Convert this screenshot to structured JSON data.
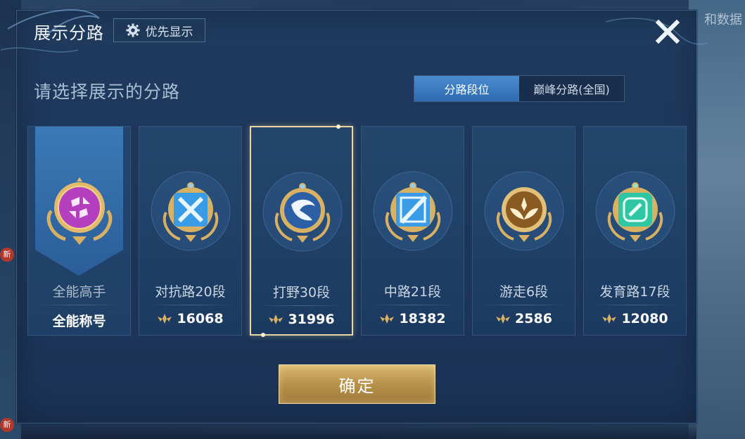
{
  "background": {
    "top_right_text": "和数据",
    "badge_text": "新"
  },
  "dialog": {
    "title": "展示分路",
    "priority_label": "优先显示",
    "subtitle": "请选择展示的分路",
    "tabs": [
      {
        "label": "分路段位",
        "active": true
      },
      {
        "label": "巅峰分路(全国)",
        "active": false
      }
    ],
    "cards": [
      {
        "name": "全能高手",
        "score": "全能称号",
        "emblem": "all-round-emblem-icon",
        "color": "#b43fbf",
        "selected": false
      },
      {
        "name": "对抗路20段",
        "score": "16068",
        "emblem": "clash-lane-emblem-icon",
        "color": "#3a9be6",
        "selected": false
      },
      {
        "name": "打野30段",
        "score": "31996",
        "emblem": "jungle-dragon-emblem-icon",
        "color": "#3d6fb8",
        "selected": true
      },
      {
        "name": "中路21段",
        "score": "18382",
        "emblem": "mid-lane-emblem-icon",
        "color": "#3a9be6",
        "selected": false
      },
      {
        "name": "游走6段",
        "score": "2586",
        "emblem": "roam-emblem-icon",
        "color": "#c98f3d",
        "selected": false
      },
      {
        "name": "发育路17段",
        "score": "12080",
        "emblem": "farm-lane-emblem-icon",
        "color": "#2fc7a3",
        "selected": false
      }
    ],
    "confirm_label": "确定"
  },
  "colors": {
    "accent_blue": "#2e6bb0",
    "gold": "#c9a25a",
    "selection": "#e9d6a0"
  }
}
